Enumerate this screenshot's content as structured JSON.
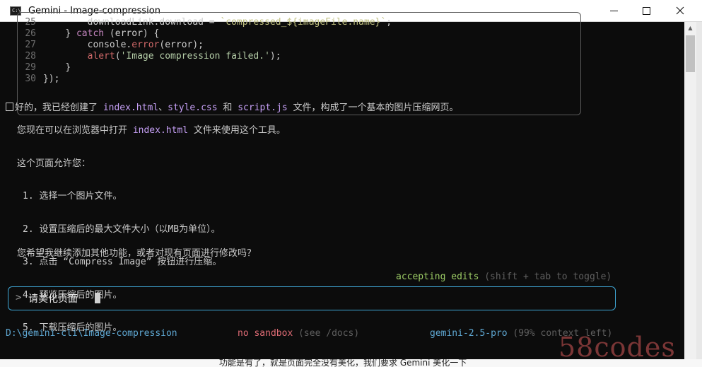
{
  "window": {
    "title": "Gemini - Image-compression",
    "icon_label": "C:\\",
    "icon": "console-icon",
    "minimize_icon": "minimize-icon",
    "maximize_icon": "maximize-icon",
    "close_icon": "close-icon"
  },
  "code": {
    "lines": [
      {
        "num": "25",
        "indent": "        ",
        "parts": [
          {
            "t": "downloadLink.download = ",
            "c": ""
          },
          {
            "t": "`compressed_${imageFile.name}`",
            "c": "tpl"
          },
          {
            "t": ";",
            "c": ""
          }
        ]
      },
      {
        "num": "26",
        "indent": "    ",
        "parts": [
          {
            "t": "} ",
            "c": ""
          },
          {
            "t": "catch",
            "c": "kw"
          },
          {
            "t": " (error) {",
            "c": ""
          }
        ]
      },
      {
        "num": "27",
        "indent": "        ",
        "parts": [
          {
            "t": "console.",
            "c": ""
          },
          {
            "t": "error",
            "c": "fn"
          },
          {
            "t": "(error);",
            "c": ""
          }
        ]
      },
      {
        "num": "28",
        "indent": "        ",
        "parts": [
          {
            "t": "alert",
            "c": "fn"
          },
          {
            "t": "(",
            "c": ""
          },
          {
            "t": "'Image compression failed.'",
            "c": "str"
          },
          {
            "t": ");",
            "c": ""
          }
        ]
      },
      {
        "num": "29",
        "indent": "    ",
        "parts": [
          {
            "t": "}",
            "c": ""
          }
        ]
      },
      {
        "num": "30",
        "indent": "",
        "parts": [
          {
            "t": "});",
            "c": ""
          }
        ]
      }
    ]
  },
  "messages": {
    "created_prefix": "好的，我已经创建了 ",
    "file_html": "index.html",
    "sep1": "、",
    "file_css": "style.css",
    "and": " 和 ",
    "file_js": "script.js",
    "created_suffix": " 文件，构成了一个基本的图片压缩网页。",
    "open_prefix": "您现在可以在浏览器中打开 ",
    "open_file": "index.html",
    "open_suffix": " 文件来使用这个工具。",
    "allows": "这个页面允许您：",
    "steps": [
      "1. 选择一个图片文件。",
      "2. 设置压缩后的最大文件大小（以MB为单位）。",
      "3. 点击 “Compress Image” 按钮进行压缩。",
      "4. 预览压缩后的图片。",
      "5. 下载压缩后的图片。"
    ],
    "question": "您希望我继续添加其他功能，或者对现有页面进行修改吗？"
  },
  "status": {
    "accepting": "accepting edits",
    "accepting_hint": " (shift + tab to toggle)"
  },
  "input": {
    "prompt": ">",
    "value": "请美化页面"
  },
  "footer": {
    "path": "D:\\gemini-cli\\Image-compression",
    "sandbox": "no sandbox",
    "sandbox_hint": " (see /docs)",
    "model": "gemini-2.5-pro",
    "context": " (99% context left)"
  },
  "watermark": "58codes",
  "background_text": "功能是有了，就是页面完全没有美化，我们要求 Gemini 美化一下"
}
